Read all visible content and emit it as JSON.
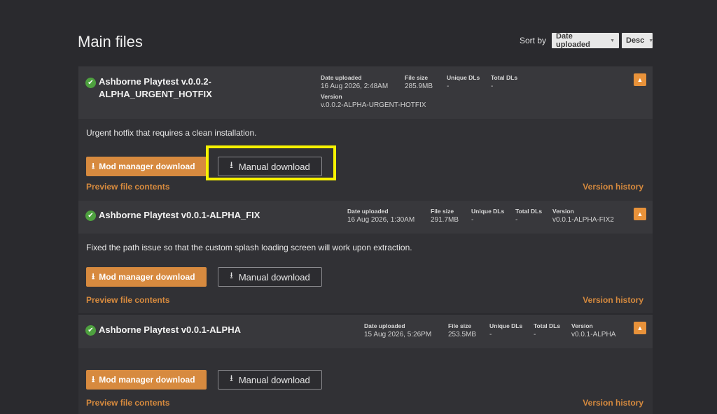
{
  "page": {
    "title": "Main files"
  },
  "sort": {
    "label": "Sort by",
    "field": "Date uploaded",
    "direction": "Desc"
  },
  "labels": {
    "date_uploaded": "Date uploaded",
    "file_size": "File size",
    "unique_dls": "Unique DLs",
    "total_dls": "Total DLs",
    "version": "Version"
  },
  "files": [
    {
      "name_line1": "Ashborne Playtest v.0.0.2-",
      "name_line2": "ALPHA_URGENT_HOTFIX",
      "date_uploaded": "16 Aug 2026, 2:48AM",
      "file_size": "285.9MB",
      "unique_dls": "-",
      "total_dls": "-",
      "version": "v.0.0.2-ALPHA-URGENT-HOTFIX",
      "description": "Urgent hotfix that requires a clean installation.",
      "mod_manager_label": "Mod manager download",
      "manual_label": "Manual download",
      "preview_label": "Preview file contents",
      "history_label": "Version history"
    },
    {
      "name_line1": "Ashborne Playtest v0.0.1-ALPHA_FIX",
      "date_uploaded": "16 Aug 2026, 1:30AM",
      "file_size": "291.7MB",
      "unique_dls": "-",
      "total_dls": "-",
      "version": "v0.0.1-ALPHA-FIX2",
      "description": "Fixed the path issue so that the custom splash loading screen will work upon extraction.",
      "mod_manager_label": "Mod manager download",
      "manual_label": "Manual download",
      "preview_label": "Preview file contents",
      "history_label": "Version history"
    },
    {
      "name_line1": "Ashborne Playtest v0.0.1-ALPHA",
      "date_uploaded": "15 Aug 2026, 5:26PM",
      "file_size": "253.5MB",
      "unique_dls": "-",
      "total_dls": "-",
      "version": "v0.0.1-ALPHA",
      "description": "",
      "mod_manager_label": "Mod manager download",
      "manual_label": "Manual download",
      "preview_label": "Preview file contents",
      "history_label": "Version history"
    }
  ],
  "colors": {
    "accent": "#d78a3f",
    "check": "#4ea13f",
    "highlight": "#f7f200",
    "background": "#2a2a2e"
  }
}
